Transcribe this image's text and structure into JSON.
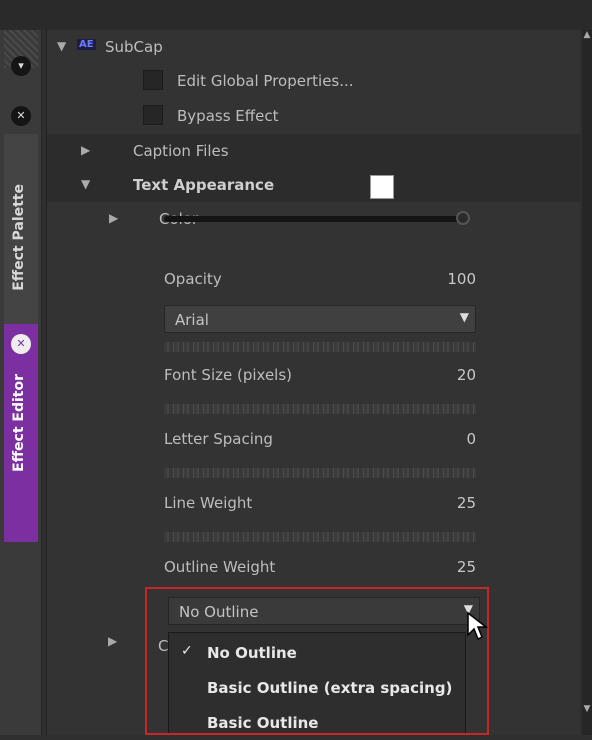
{
  "side_tabs": {
    "palette_label": "Effect Palette",
    "editor_label": "Effect Editor"
  },
  "effect": {
    "badge": "AE",
    "name": "SubCap",
    "edit_global_label": "Edit Global Properties...",
    "bypass_label": "Bypass Effect"
  },
  "groups": {
    "caption_files": "Caption Files",
    "text_appearance": "Text Appearance"
  },
  "properties": {
    "color_label": "Color",
    "color_value": "#ffffff",
    "opacity_label": "Opacity",
    "opacity_value": "100",
    "font_value": "Arial",
    "font_size_label": "Font Size (pixels)",
    "font_size_value": "20",
    "letter_spacing_label": "Letter Spacing",
    "letter_spacing_value": "0",
    "line_weight_label": "Line Weight",
    "line_weight_value": "25",
    "outline_weight_label": "Outline Weight",
    "outline_weight_value": "25",
    "outline_select_value": "No Outline",
    "clipped_row_label": "C"
  },
  "outline_dropdown": {
    "items": [
      {
        "label": "No Outline",
        "checked": true
      },
      {
        "label": "Basic Outline (extra spacing)",
        "checked": false
      },
      {
        "label": "Basic Outline",
        "checked": false
      }
    ]
  },
  "colors": {
    "accent_tab": "#7b2fa0",
    "highlight_box": "#c62828"
  }
}
